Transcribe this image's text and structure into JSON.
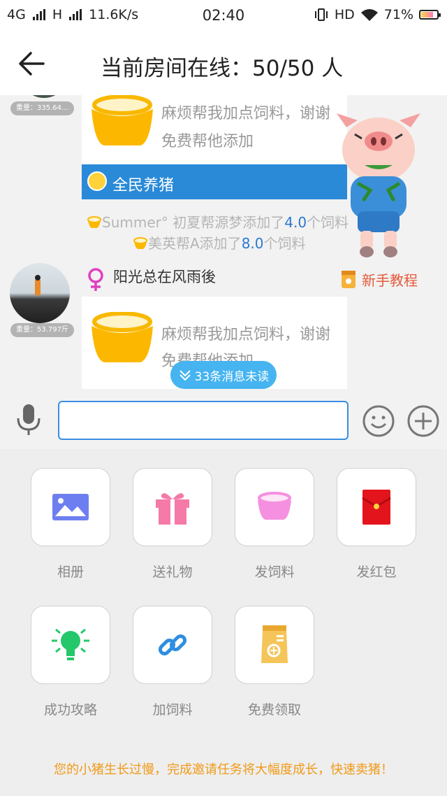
{
  "status_bar": {
    "left_text": "4G",
    "h_text": "H",
    "speed": "11.6K/s",
    "time": "02:40",
    "hd": "HD",
    "battery": "71%"
  },
  "header": {
    "title": "当前房间在线：50/50 人",
    "back_icon": "arrow-left-icon"
  },
  "chat": {
    "messages": [
      {
        "weight": "重量：335.64…",
        "text_line1": "麻烦帮我加点饲料，谢谢",
        "text_line2": "免费帮他添加",
        "banner": "全民养猪"
      },
      {
        "username": "阳光总在风雨後",
        "weight": "重量：53.797斤",
        "text_line1": "麻烦帮我加点饲料，谢谢",
        "text_line2": "免费帮他添加"
      }
    ],
    "system_lines": [
      {
        "pre": "Summer° 初夏帮源梦添加了",
        "num": "4.0",
        "post": "个饲料"
      },
      {
        "pre": "美英帮A添加了",
        "num": "8.0",
        "post": "个饲料"
      }
    ],
    "tutorial": "新手教程",
    "unread": "33条消息未读"
  },
  "input": {
    "placeholder": "",
    "value": ""
  },
  "tools": [
    {
      "label": "相册",
      "icon": "photo-album-icon",
      "color": "#6d7ff0"
    },
    {
      "label": "送礼物",
      "icon": "gift-icon",
      "color": "#f57aa8"
    },
    {
      "label": "发饲料",
      "icon": "feed-bowl-icon",
      "color": "#f590e0"
    },
    {
      "label": "发红包",
      "icon": "red-envelope-icon",
      "color": "#e4141c"
    },
    {
      "label": "成功攻略",
      "icon": "lightbulb-icon",
      "color": "#24c86a"
    },
    {
      "label": "加饲料",
      "icon": "link-icon",
      "color": "#2f8ee0"
    },
    {
      "label": "免费领取",
      "icon": "feed-bag-icon",
      "color": "#f5c55a"
    }
  ],
  "promo": "您的小猪生长过慢，完成邀请任务将大幅度成长，快速卖猪！"
}
